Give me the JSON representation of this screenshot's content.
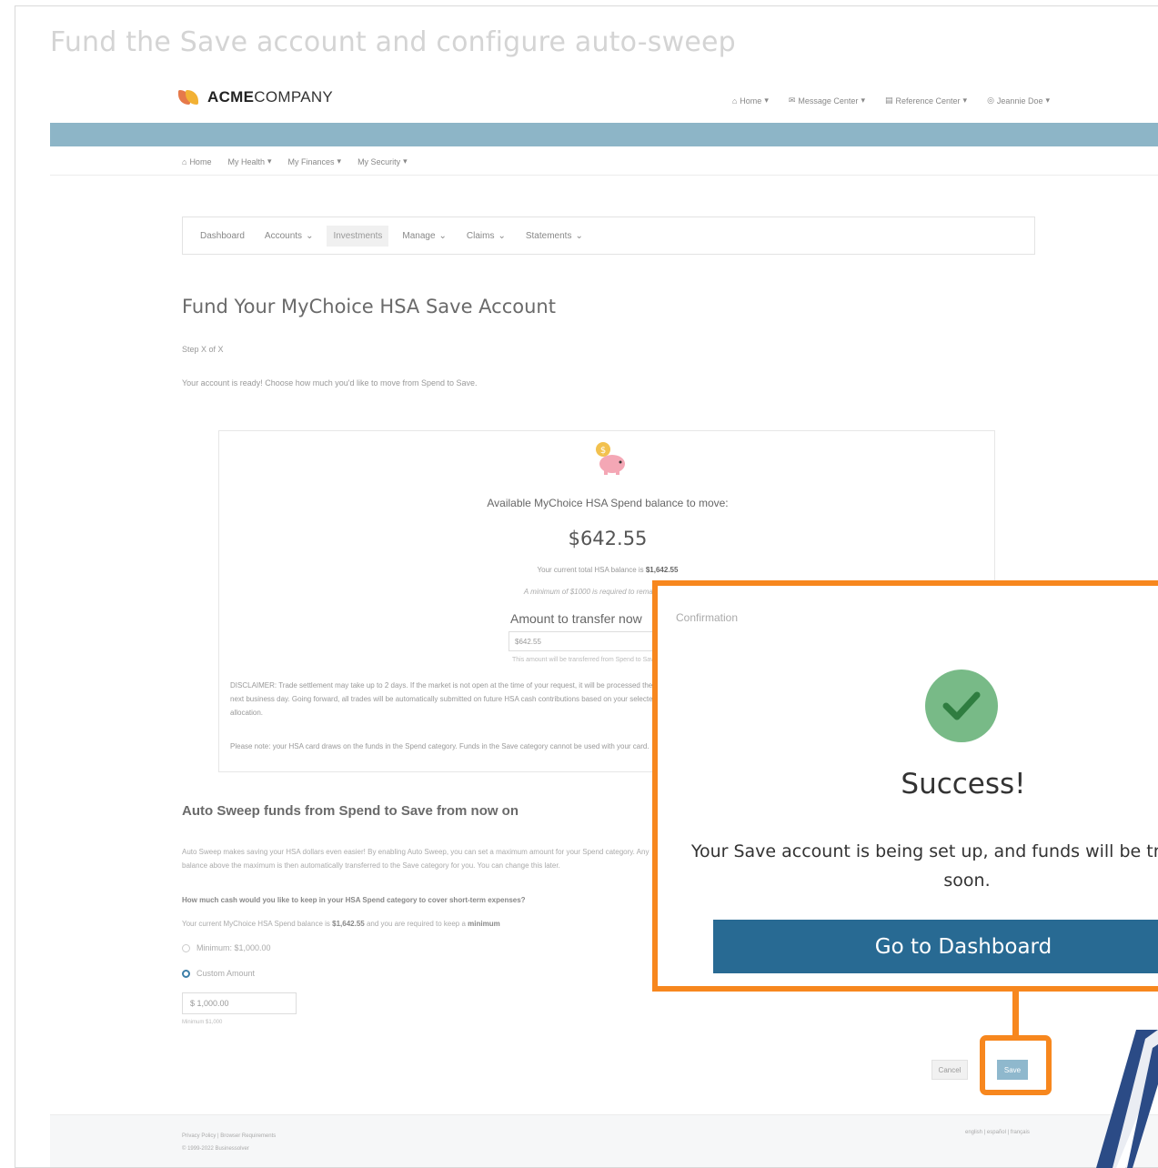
{
  "slide": {
    "title": "Fund the Save account and configure auto-sweep"
  },
  "topbar": {
    "logo_bold": "ACME",
    "logo_rest": "COMPANY",
    "links": [
      "Home",
      "Message Center",
      "Reference Center",
      "Jeannie Doe"
    ]
  },
  "main_nav": {
    "items": [
      "Home",
      "My Health",
      "My Finances",
      "My Security"
    ]
  },
  "sub_nav": {
    "tabs": [
      "Dashboard",
      "Accounts",
      "Investments",
      "Manage",
      "Claims",
      "Statements"
    ],
    "active": "Investments"
  },
  "fund": {
    "heading": "Fund Your MyChoice HSA Save Account",
    "step": "Step X of X",
    "ready_text": "Your account is ready! Choose how much you'd like to move from Spend to Save."
  },
  "card": {
    "available_label": "Available MyChoice HSA Spend balance to move:",
    "amount": "$642.55",
    "current_total_prefix": "Your current total HSA balance is ",
    "current_total_value": "$1,642.55",
    "minimum_note": "A minimum of $1000 is required to remain in Spend.",
    "transfer_label": "Amount to transfer now",
    "transfer_value": "$642.55",
    "transfer_note": "This amount will be transferred from Spend to Save.",
    "disclaimer": "DISCLAIMER: Trade settlement may take up to 2 days. If the market is not open at the time of your request, it will be processed the next business day. Going forward, all trades will be automatically submitted on future HSA cash contributions based on your selected allocation.",
    "note": "Please note: your HSA card draws on the funds in the Spend category. Funds in the Save category cannot be used with your card."
  },
  "sweep": {
    "heading": "Auto Sweep funds from Spend to Save from now on",
    "description": "Auto Sweep makes saving your HSA dollars even easier! By enabling Auto Sweep, you can set a maximum amount for your Spend category. Any balance above the maximum is then automatically transferred to the Save category for you. You can change this later.",
    "question": "How much cash would you like to keep in your HSA Spend category to cover short-term expenses?",
    "balance_prefix": "Your current MyChoice HSA Spend balance is ",
    "balance_value": "$1,642.55",
    "balance_mid": " and you are required to keep a ",
    "balance_bold": "minimum",
    "option_minimum": "Minimum: $1,000.00",
    "option_custom": "Custom Amount",
    "custom_value": "$  1,000.00",
    "custom_note": "Minimum $1,000"
  },
  "actions": {
    "cancel": "Cancel",
    "save": "Save"
  },
  "footer": {
    "links": "Privacy Policy | Browser Requirements",
    "copyright": "© 1999-2022 Businessolver",
    "languages": "english | español | français"
  },
  "modal": {
    "label": "Confirmation",
    "title": "Success!",
    "message": "Your Save account is being set up, and funds will be transferred soon.",
    "button": "Go to Dashboard"
  },
  "colors": {
    "callout_orange": "#f7871e",
    "brand_blue": "#286a93",
    "success_green": "#78ba87",
    "header_bar": "#8db5c7"
  }
}
